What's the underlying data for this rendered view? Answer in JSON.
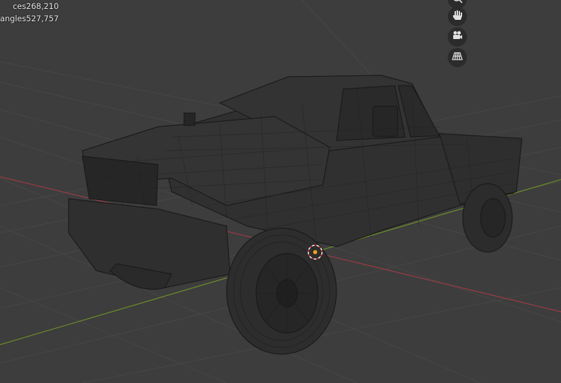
{
  "stats": {
    "vertices_label": "ces",
    "vertices_value": "268,210",
    "triangles_label": "angles",
    "triangles_value": "527,757"
  },
  "nav_gizmo": {
    "buttons": [
      "zoom-icon",
      "hand-pan-icon",
      "camera-icon",
      "grid-ortho-icon"
    ]
  },
  "viewport": {
    "shading": "wireframe",
    "background": "#3d3d3d",
    "grid_color": "#4a4a4a",
    "x_axis_color": "#9a3c44",
    "y_axis_color": "#6b8a2a",
    "object": "pickup-truck-mesh",
    "origin_marker_color": "#f0a020"
  }
}
